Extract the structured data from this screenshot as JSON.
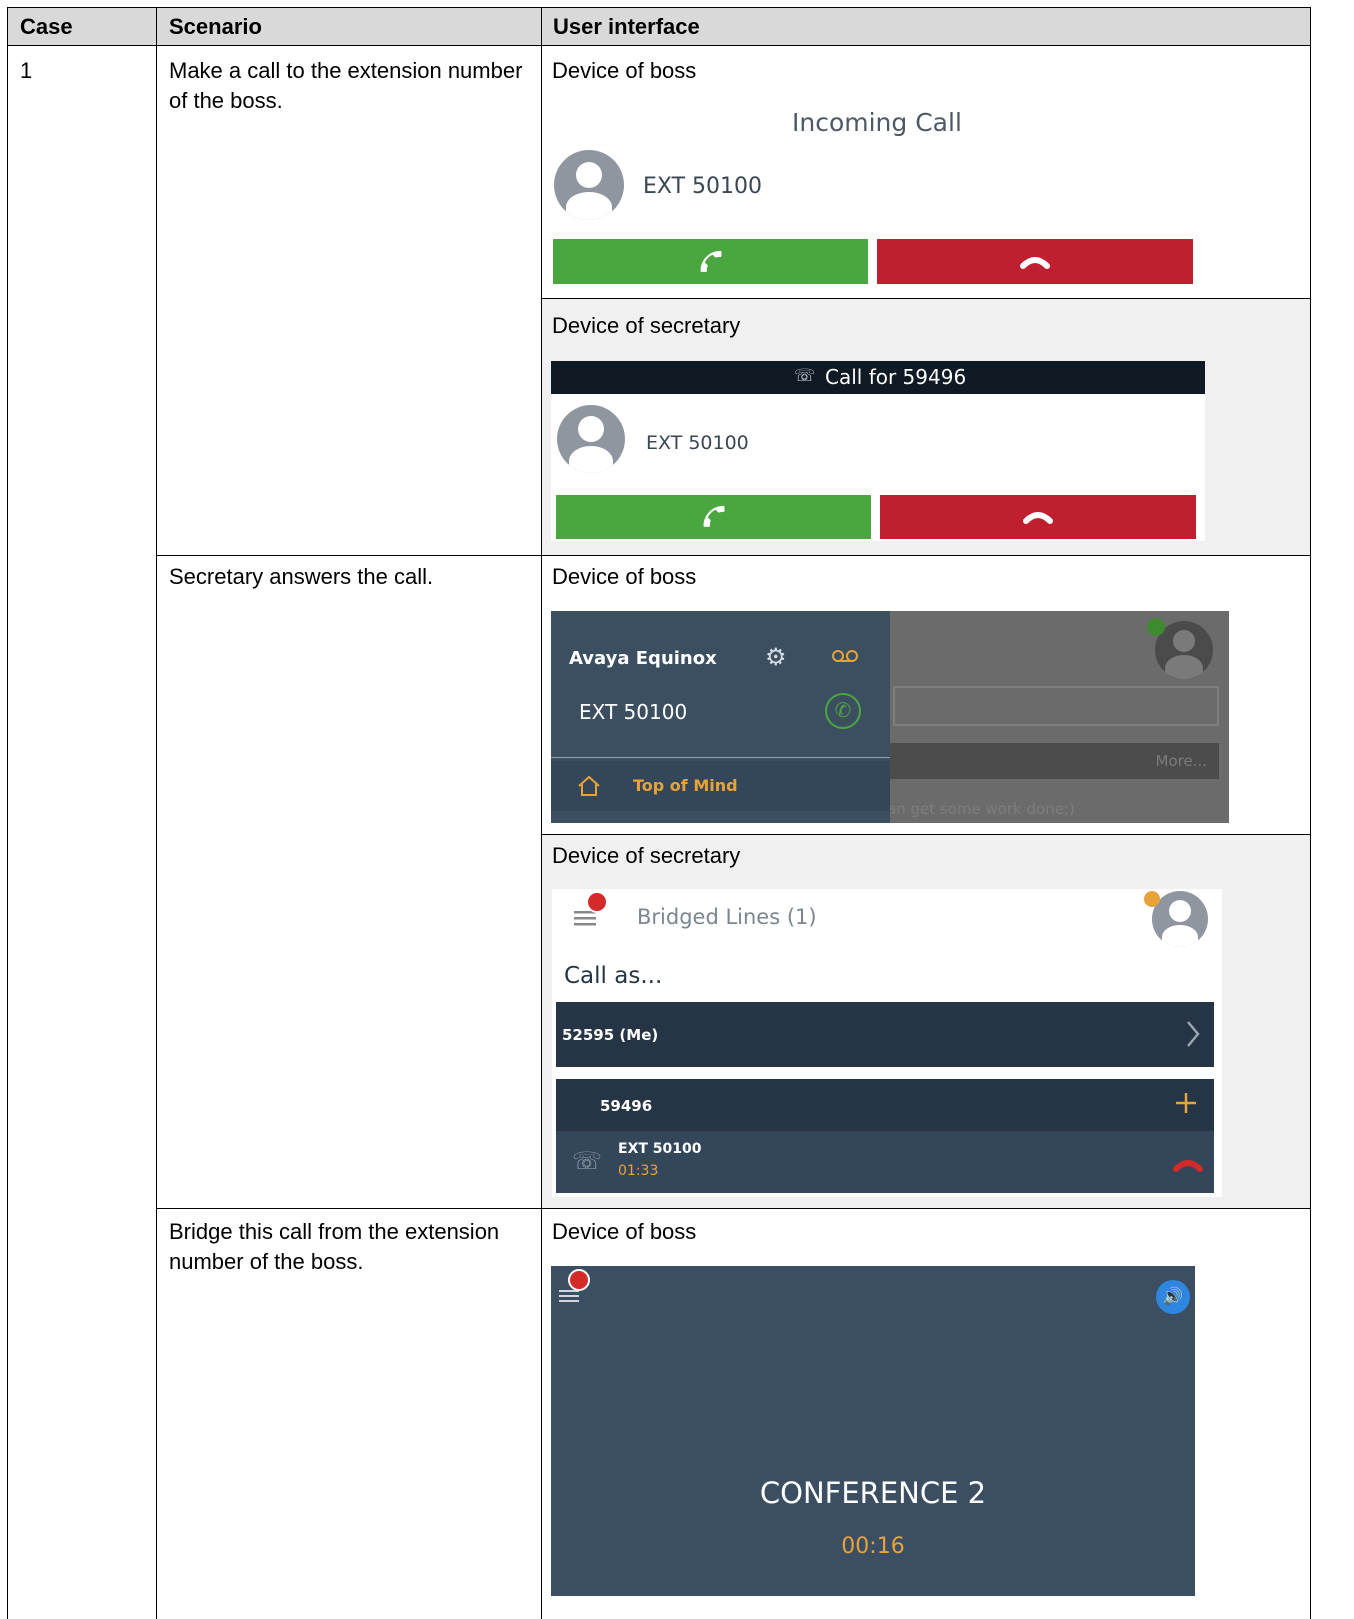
{
  "table": {
    "headers": {
      "case": "Case",
      "scenario": "Scenario",
      "ui": "User interface"
    },
    "case_number": "1",
    "rows": [
      {
        "scenario": "Make a call to the extension number of the boss."
      },
      {
        "scenario": "Secretary answers the call."
      },
      {
        "scenario": "Bridge this call from the extension number of the boss."
      }
    ]
  },
  "labels": {
    "device_boss": "Device of boss",
    "device_secretary": "Device of secretary"
  },
  "s1_boss": {
    "title": "Incoming Call",
    "caller": "EXT 50100"
  },
  "s1_secretary": {
    "bar_title": "Call for 59496",
    "caller": "EXT 50100"
  },
  "s2_boss": {
    "app_name": "Avaya Equinox",
    "ext": "EXT 50100",
    "menu_item": "Top of Mind",
    "more": "More...",
    "bg_text": "an get some work done;)"
  },
  "s2_secretary": {
    "title": "Bridged Lines (1)",
    "call_as": "Call as...",
    "line_me": "52595 (Me)",
    "line_boss": "59496",
    "call_ext": "EXT 50100",
    "call_time": "01:33"
  },
  "s3_boss": {
    "conference": "CONFERENCE 2",
    "time": "00:16"
  },
  "colors": {
    "answer_green": "#4aa63f",
    "decline_red": "#c01f2f",
    "dark_panel": "#3c4f61",
    "orange_accent": "#e8a23a"
  },
  "icons": [
    "phone-answer-icon",
    "phone-hangup-icon",
    "user-avatar-icon",
    "gear-icon",
    "voicemail-icon",
    "home-icon",
    "hamburger-menu-icon",
    "plus-icon",
    "chevron-right-icon",
    "speaker-icon",
    "bridged-call-icon"
  ]
}
